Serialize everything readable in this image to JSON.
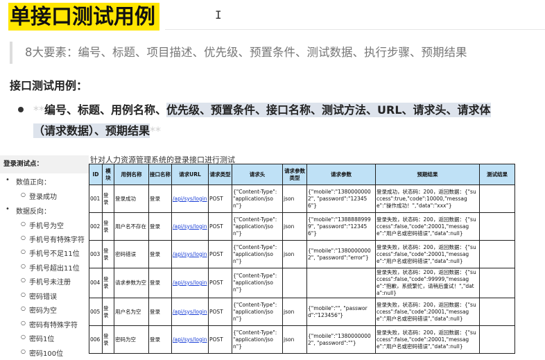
{
  "doc": {
    "title": "单接口测试用例",
    "cursor_glyph": "I",
    "quote": "8大要素：编号、标题、项目描述、优先级、预置条件、测试数据、执行步骤、预期结果",
    "subhead": "接口测试用例：",
    "bullet": {
      "stars_open": "**",
      "plain": "编号、标题、用例名称、",
      "highlighted_1": "优先级、预置条件、接口名称、测试方法、URL、请求头、请求体",
      "highlighted_2": "（请求数据）、预期结果",
      "stars_close": "**"
    }
  },
  "left_panel": {
    "header": "登录测试点：",
    "positive_label": "数值正向：",
    "positive_items": [
      "登录成功"
    ],
    "negative_label": "数据反向：",
    "negative_items": [
      "手机号为空",
      "手机号有特殊字符",
      "手机号不足11位",
      "手机号超出11位",
      "手机号未注册",
      "密码错误",
      "密码为空",
      "密码有特殊字符",
      "密码1位",
      "密码100位"
    ]
  },
  "table": {
    "caption": "针对人力资源管理系统的登录接口进行测试",
    "headers": [
      "ID",
      "模块",
      "用例名称",
      "接口名称",
      "请求URL",
      "请求类型",
      "请求头",
      "请求参数类型",
      "请求参数",
      "预期结果",
      "测试结果"
    ],
    "rows": [
      [
        "001",
        "登录",
        "登录成功",
        "登录",
        "/api/sys/login",
        "POST",
        "{\"Content-Type\": \"application/json\"}",
        "json",
        "{\"mobile\":\"13800000002\", \"password\":\"123456\"}",
        "登录成功，状态码：200，返回数据：{\"success\":true,\"code\":10000,\"message\":\"操作成功！\",\"data\":\"xxx\"}",
        ""
      ],
      [
        "002",
        "登录",
        "用户名不存在",
        "登录",
        "/api/sys/login",
        "POST",
        "{\"Content-Type\": \"application/json\"}",
        "json",
        "{\"mobile\":\"13888889999\", \"password\":\"123456\"}",
        "登录失败，状态码：200，返回数据：{\"success\":false,\"code\":20001,\"message\":\"用户名或密码错误\",\"data\":null}",
        ""
      ],
      [
        "003",
        "登录",
        "密码错误",
        "登录",
        "/api/sys/login",
        "POST",
        "{\"Content-Type\": \"application/json\"}",
        "json",
        "{\"mobile\":\"13800000002\", \"password\":\"error\"}",
        "登录失败，状态码：200，返回数据：{\"success\":false,\"code\":20001,\"message\":\"用户名或密码错误\",\"data\":null}",
        ""
      ],
      [
        "004",
        "登录",
        "请求参数为空",
        "登录",
        "/api/sys/login",
        "POST",
        "{\"Content-Type\": \"application/json\"}",
        "",
        "",
        "登录失败，状态码：200，返回数据：{\"success\":false,\"code\":99999,\"message\":\"抱歉，系统繁忙，请稍后重试！\",\"data\":null}",
        ""
      ],
      [
        "005",
        "登录",
        "用户名为空",
        "登录",
        "/api/sys/login",
        "POST",
        "{\"Content-Type\": \"application/json\"}",
        "json",
        "{\"mobile\":\"\", \"password\":\"123456\"}",
        "登录失败，状态码：200，返回数据：{\"success\":false,\"code\":20001,\"message\":\"用户名或密码错误\",\"data\":null}",
        ""
      ],
      [
        "006",
        "登录",
        "密码为空",
        "登录",
        "/api/sys/login",
        "POST",
        "{\"Content-Type\": \"application/json\"}",
        "json",
        "{\"mobile\":\"13800000002\", \"password\":\"\"}",
        "登录失败，状态码：200，返回数据：{\"success\":false,\"code\":20001,\"message\":\"用户名或密码错误\",\"data\":null}",
        ""
      ]
    ]
  },
  "colors": {
    "title_highlight": "#ffe600",
    "table_header": "#bfe1f6",
    "link": "#1a3fd6",
    "bullet_highlight": "#dde3ec"
  }
}
